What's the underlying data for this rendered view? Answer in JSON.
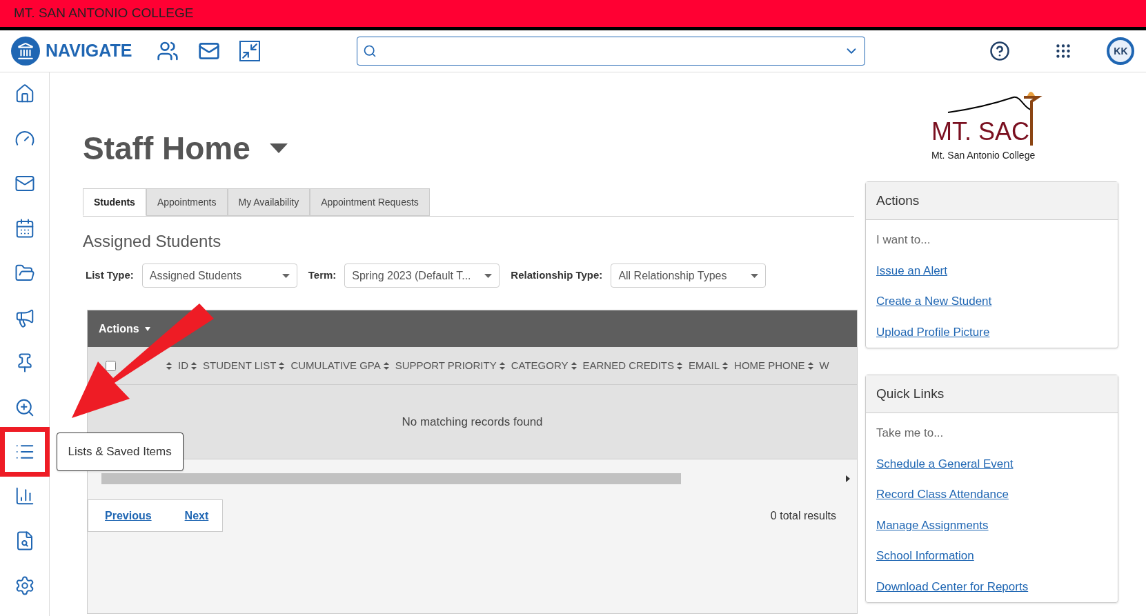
{
  "banner": {
    "title": "MT. SAN ANTONIO COLLEGE"
  },
  "header": {
    "brand": "NAVIGATE",
    "avatar": "KK"
  },
  "sidebar": {
    "items": [
      {
        "highlighted": false
      },
      {
        "highlighted": false
      },
      {
        "highlighted": false
      },
      {
        "highlighted": false
      },
      {
        "highlighted": false
      },
      {
        "highlighted": false
      },
      {
        "highlighted": false
      },
      {
        "highlighted": false
      },
      {
        "highlighted": true,
        "tooltip": "Lists & Saved Items"
      },
      {
        "highlighted": false
      },
      {
        "highlighted": false
      },
      {
        "highlighted": false
      }
    ]
  },
  "page": {
    "title": "Staff Home",
    "tabs": [
      {
        "label": "Students",
        "selected": true
      },
      {
        "label": "Appointments",
        "selected": false
      },
      {
        "label": "My Availability",
        "selected": false
      },
      {
        "label": "Appointment Requests",
        "selected": false
      }
    ],
    "section_title": "Assigned Students",
    "filters": [
      {
        "label": "List Type:",
        "value": "Assigned Students"
      },
      {
        "label": "Term:",
        "value": "Spring 2023 (Default T..."
      },
      {
        "label": "Relationship Type:",
        "value": "All Relationship Types"
      }
    ],
    "table": {
      "actions": "Actions",
      "select_all": {
        "checked": false
      },
      "columns": [
        "ID",
        "STUDENT LIST",
        "CUMULATIVE GPA",
        "SUPPORT PRIORITY",
        "CATEGORY",
        "EARNED CREDITS",
        "EMAIL",
        "HOME PHONE",
        "W"
      ],
      "empty_message": "No matching records found"
    },
    "pagination": {
      "previous": "Previous",
      "next": "Next",
      "total": "0 total results"
    }
  },
  "logo": {
    "name": "MT. SAC",
    "subtitle": "Mt. San Antonio College"
  },
  "panels": [
    {
      "title": "Actions",
      "intro": "I want to...",
      "links": [
        "Issue an Alert",
        "Create a New Student",
        "Upload Profile Picture"
      ]
    },
    {
      "title": "Quick Links",
      "intro": "Take me to...",
      "links": [
        "Schedule a General Event",
        "Record Class Attendance",
        "Manage Assignments",
        "School Information",
        "Download Center for Reports"
      ]
    }
  ]
}
